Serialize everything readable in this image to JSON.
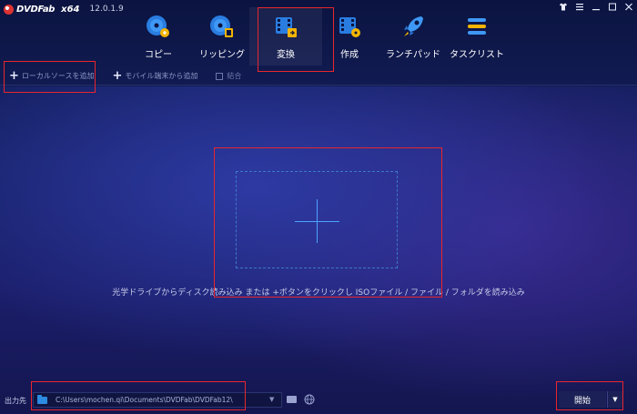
{
  "app": {
    "brand": "DVDFab",
    "arch": "x64",
    "version": "12.0.1.9"
  },
  "window_controls": [
    "shirt-icon",
    "menu-icon",
    "minimize-icon",
    "maximize-icon",
    "close-icon"
  ],
  "nav": [
    {
      "label": "コピー",
      "icon": "disc-copy-icon",
      "active": false
    },
    {
      "label": "リッピング",
      "icon": "disc-ripper-icon",
      "active": false
    },
    {
      "label": "変換",
      "icon": "film-converter-icon",
      "active": true
    },
    {
      "label": "作成",
      "icon": "film-creator-icon",
      "active": false
    },
    {
      "label": "ランチパッド",
      "icon": "rocket-icon",
      "active": false
    },
    {
      "label": "タスクリスト",
      "icon": "task-list-icon",
      "active": false
    }
  ],
  "toolbar": {
    "add_local": "ローカルソースを追加",
    "add_mobile": "モバイル端末から追加",
    "merge": "結合"
  },
  "main": {
    "hint": "光学ドライブからディスク読み込み または +ボタンをクリックし ISOファイル / ファイル / フォルダを読み込み"
  },
  "output": {
    "label": "出力先",
    "path": "C:\\Users\\mochen.qi\\Documents\\DVDFab\\DVDFab12\\"
  },
  "start": {
    "label": "開始"
  },
  "colors": {
    "highlight": "#e8262c",
    "accent": "#4aa3ff",
    "background_top": "#0f1b52",
    "background_center": "#2e3aa3"
  }
}
